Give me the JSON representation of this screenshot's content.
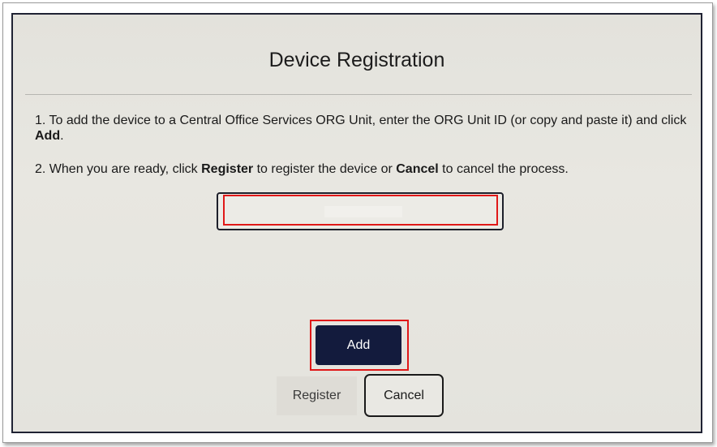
{
  "dialog": {
    "title": "Device Registration",
    "instruction_1": {
      "part_a": "1. To add the device to a Central Office Services ORG Unit, enter the ORG Unit ID (or copy and paste it) and click ",
      "bold": "Add",
      "part_b": "."
    },
    "instruction_2": {
      "part_a": "2. When you are ready, click ",
      "bold_1": "Register",
      "part_b": " to register the device or ",
      "bold_2": "Cancel",
      "part_c": " to cancel the process."
    },
    "org_unit_input": {
      "value": "",
      "placeholder": ""
    },
    "buttons": {
      "add": "Add",
      "register": "Register",
      "cancel": "Cancel"
    }
  },
  "colors": {
    "highlight": "#e01818",
    "primary_button": "#131b3d",
    "screen_background": "#e5e4de"
  }
}
